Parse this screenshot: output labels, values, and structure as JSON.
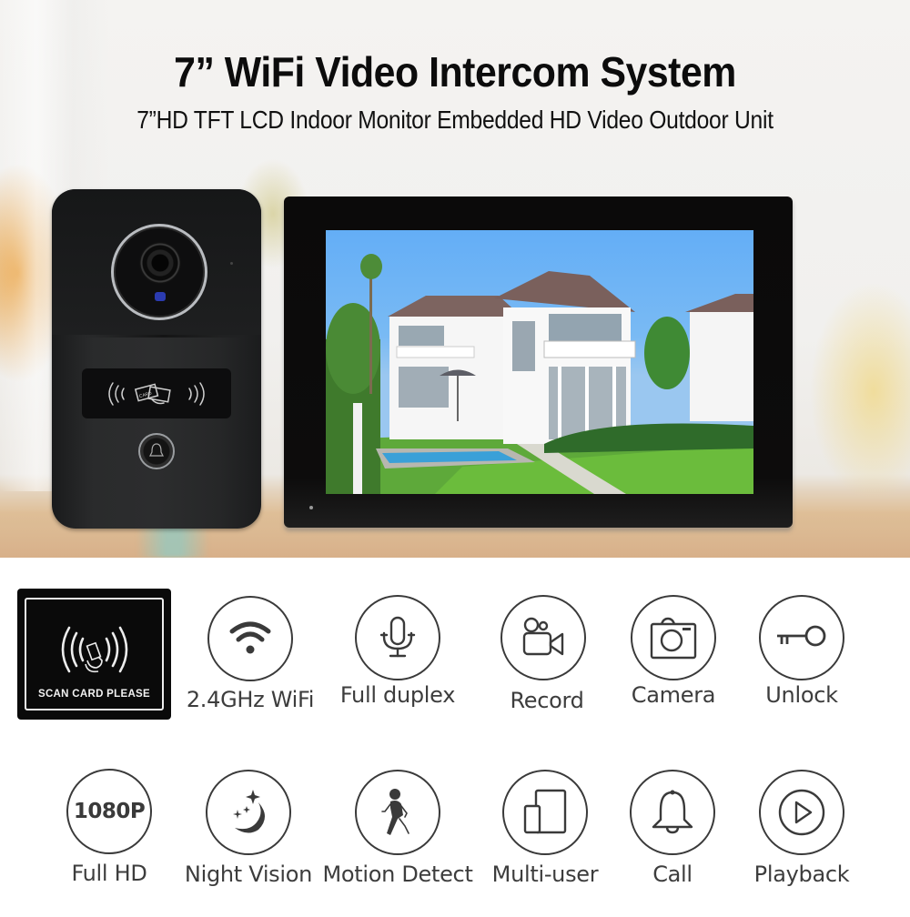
{
  "header": {
    "title": "7” WiFi  Video Intercom System",
    "subtitle": "7”HD TFT LCD Indoor Monitor Embedded HD Video Outdoor Unit"
  },
  "products": {
    "outdoor_unit": {
      "name": "Outdoor Unit",
      "card_reader_text": "CARD"
    },
    "indoor_monitor": {
      "name": "Indoor Monitor",
      "screen_content": "villa-with-pool"
    }
  },
  "scan_card": {
    "label": "SCAN CARD PLEASE",
    "icon": "nfc-card-scan-icon"
  },
  "features_row1": [
    {
      "label": "2.4GHz WiFi",
      "icon": "wifi-icon"
    },
    {
      "label": "Full duplex",
      "icon": "microphone-icon"
    },
    {
      "label": "Record",
      "icon": "video-camera-icon"
    },
    {
      "label": "Camera",
      "icon": "photo-camera-icon"
    },
    {
      "label": "Unlock",
      "icon": "key-icon"
    }
  ],
  "features_row2": [
    {
      "label": "Full HD",
      "icon": "1080p-icon",
      "icon_text": "1080P"
    },
    {
      "label": "Night Vision",
      "icon": "moon-stars-icon"
    },
    {
      "label": "Motion Detect",
      "icon": "walking-person-icon"
    },
    {
      "label": "Multi-user",
      "icon": "devices-icon"
    },
    {
      "label": "Call",
      "icon": "bell-icon"
    },
    {
      "label": "Playback",
      "icon": "play-icon"
    }
  ],
  "colors": {
    "icon_stroke": "#3a3a3a",
    "label_text": "#3d3d3d",
    "title_text": "#0c0c0c",
    "device_body": "#2a2b2c",
    "monitor_bezel": "#0b0a0a"
  }
}
